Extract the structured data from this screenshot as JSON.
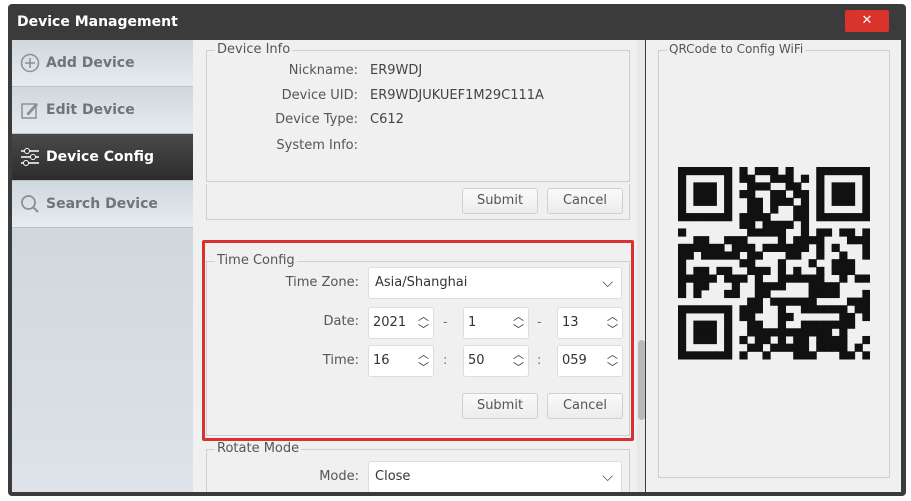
{
  "window": {
    "title": "Device Management",
    "close": "✕"
  },
  "sidebar": {
    "items": [
      {
        "label": "Add Device"
      },
      {
        "label": "Edit Device"
      },
      {
        "label": "Device Config"
      },
      {
        "label": "Search Device"
      }
    ]
  },
  "device_info": {
    "title": "Device Info",
    "nickname_label": "Nickname:",
    "nickname": "ER9WDJ",
    "uid_label": "Device UID:",
    "uid": "ER9WDJUKUEF1M29C111A",
    "type_label": "Device Type:",
    "type": "C612",
    "sysinfo_label": "System Info:",
    "submit": "Submit",
    "cancel": "Cancel"
  },
  "time_config": {
    "title": "Time Config",
    "tz_label": "Time Zone:",
    "tz": "Asia/Shanghai",
    "date_label": "Date:",
    "year": "2021",
    "month": "1",
    "day": "13",
    "date_sep": "-",
    "time_label": "Time:",
    "hour": "16",
    "minute": "50",
    "second": "059",
    "time_sep": ":",
    "submit": "Submit",
    "cancel": "Cancel"
  },
  "rotate": {
    "title": "Rotate Mode",
    "mode_label": "Mode:",
    "mode": "Close"
  },
  "qr": {
    "title": "QRCode to Config WiFi"
  }
}
